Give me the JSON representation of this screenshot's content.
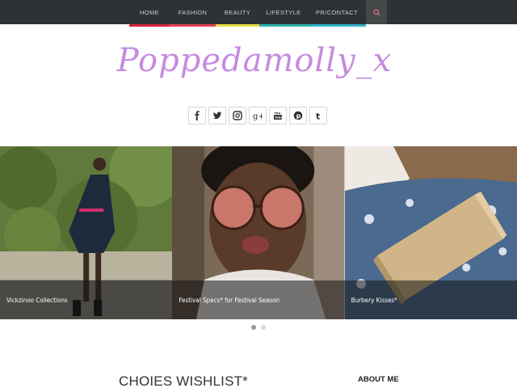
{
  "nav": {
    "items": [
      {
        "label": "HOME",
        "accent": "#d9263b"
      },
      {
        "label": "FASHION",
        "accent": "#e8415a"
      },
      {
        "label": "BEAUTY",
        "accent": "#e7e044"
      },
      {
        "label": "LIFESTYLE",
        "accent": "#2cb5a8"
      },
      {
        "label": "PR/CONTACT",
        "accent": "#31b5c9"
      }
    ],
    "search_icon": "search-icon"
  },
  "header": {
    "logo_text": "Poppedamolly_x",
    "logo_color": "#c58be0"
  },
  "social": [
    "facebook-icon",
    "twitter-icon",
    "instagram-icon",
    "google-plus-icon",
    "youtube-icon",
    "pinterest-icon",
    "tumblr-icon"
  ],
  "slider": {
    "slides": [
      {
        "caption": "Vickzinoo Collections"
      },
      {
        "caption": "Festival Specs* for Festival Season"
      },
      {
        "caption": "Burbery Kisses*"
      }
    ],
    "active_dot": 0
  },
  "main": {
    "post_title": "CHOIES WISHLIST*"
  },
  "sidebar": {
    "about_heading": "ABOUT ME"
  }
}
